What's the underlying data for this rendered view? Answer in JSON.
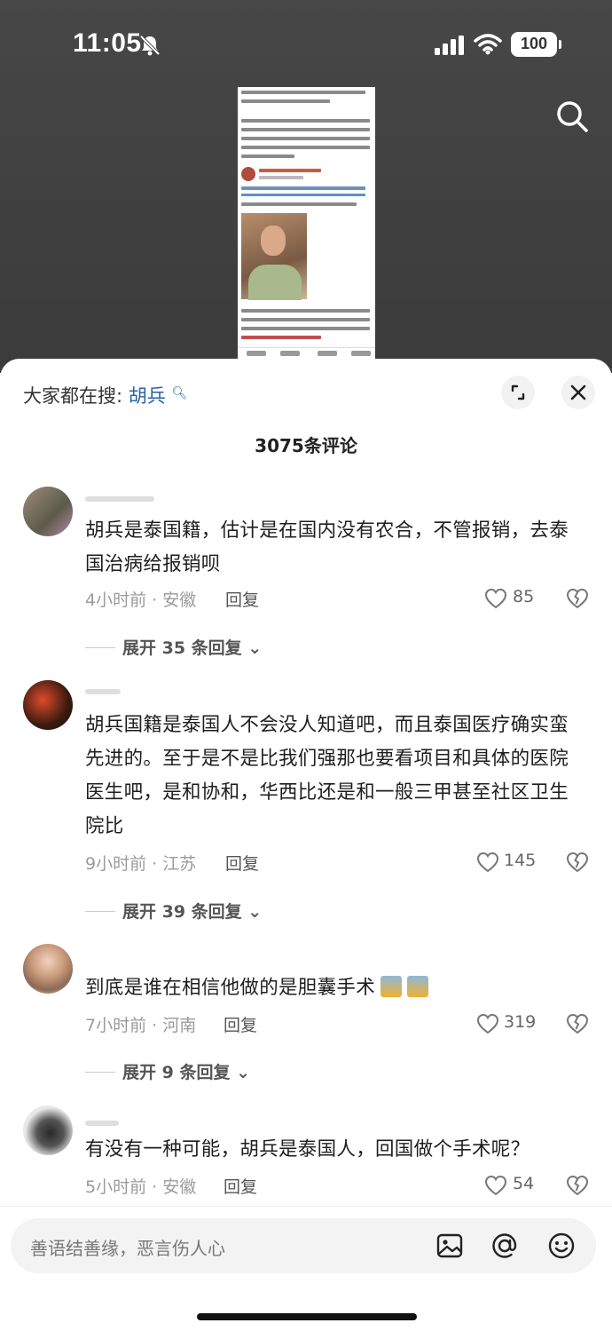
{
  "status_bar": {
    "time": "11:05",
    "battery": "100"
  },
  "panel": {
    "everyone_search_prefix": "大家都在搜:",
    "everyone_search_keyword": "胡兵",
    "comment_count_title": "3075条评论"
  },
  "comments": [
    {
      "text": "胡兵是泰国籍，估计是在国内没有农合，不管报销，去泰国治病给报销呗",
      "meta": "4小时前 · 安徽",
      "reply_label": "回复",
      "likes": "85",
      "more_replies": "展开 35 条回复"
    },
    {
      "text": "胡兵国籍是泰国人不会没人知道吧，而且泰国医疗确实蛮先进的。至于是不是比我们强那也要看项目和具体的医院医生吧，是和协和，华西比还是和一般三甲甚至社区卫生院比",
      "meta": "9小时前 · 江苏",
      "reply_label": "回复",
      "likes": "145",
      "more_replies": "展开 39 条回复"
    },
    {
      "text": "到底是谁在相信他做的是胆囊手术",
      "meta": "7小时前 · 河南",
      "reply_label": "回复",
      "likes": "319",
      "more_replies": "展开 9 条回复"
    },
    {
      "text": "有没有一种可能，胡兵是泰国人，回国做个手术呢？",
      "meta": "5小时前 · 安徽",
      "reply_label": "回复",
      "likes": "54"
    }
  ],
  "input": {
    "placeholder": "善语结善缘，恶言伤人心"
  },
  "icons": {
    "search": "search-icon",
    "expand": "expand-icon",
    "close": "close-icon",
    "like": "heart-icon",
    "dislike": "broken-heart-icon",
    "image": "image-icon",
    "mention": "at-icon",
    "emoji": "emoji-icon"
  }
}
